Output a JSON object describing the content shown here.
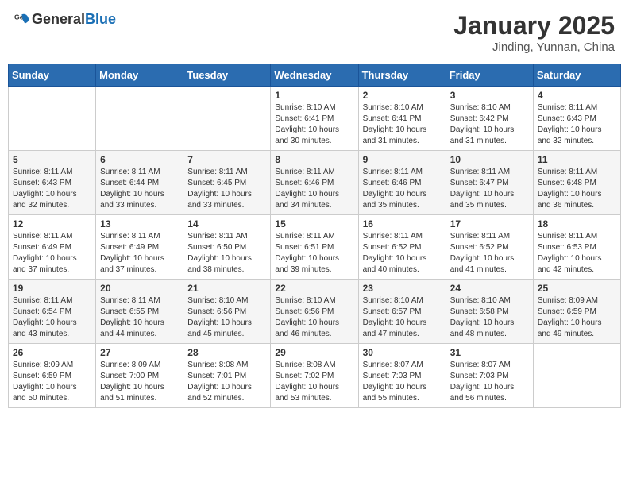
{
  "header": {
    "logo_general": "General",
    "logo_blue": "Blue",
    "month_title": "January 2025",
    "location": "Jinding, Yunnan, China"
  },
  "days_of_week": [
    "Sunday",
    "Monday",
    "Tuesday",
    "Wednesday",
    "Thursday",
    "Friday",
    "Saturday"
  ],
  "weeks": [
    [
      {
        "day": "",
        "info": ""
      },
      {
        "day": "",
        "info": ""
      },
      {
        "day": "",
        "info": ""
      },
      {
        "day": "1",
        "info": "Sunrise: 8:10 AM\nSunset: 6:41 PM\nDaylight: 10 hours\nand 30 minutes."
      },
      {
        "day": "2",
        "info": "Sunrise: 8:10 AM\nSunset: 6:41 PM\nDaylight: 10 hours\nand 31 minutes."
      },
      {
        "day": "3",
        "info": "Sunrise: 8:10 AM\nSunset: 6:42 PM\nDaylight: 10 hours\nand 31 minutes."
      },
      {
        "day": "4",
        "info": "Sunrise: 8:11 AM\nSunset: 6:43 PM\nDaylight: 10 hours\nand 32 minutes."
      }
    ],
    [
      {
        "day": "5",
        "info": "Sunrise: 8:11 AM\nSunset: 6:43 PM\nDaylight: 10 hours\nand 32 minutes."
      },
      {
        "day": "6",
        "info": "Sunrise: 8:11 AM\nSunset: 6:44 PM\nDaylight: 10 hours\nand 33 minutes."
      },
      {
        "day": "7",
        "info": "Sunrise: 8:11 AM\nSunset: 6:45 PM\nDaylight: 10 hours\nand 33 minutes."
      },
      {
        "day": "8",
        "info": "Sunrise: 8:11 AM\nSunset: 6:46 PM\nDaylight: 10 hours\nand 34 minutes."
      },
      {
        "day": "9",
        "info": "Sunrise: 8:11 AM\nSunset: 6:46 PM\nDaylight: 10 hours\nand 35 minutes."
      },
      {
        "day": "10",
        "info": "Sunrise: 8:11 AM\nSunset: 6:47 PM\nDaylight: 10 hours\nand 35 minutes."
      },
      {
        "day": "11",
        "info": "Sunrise: 8:11 AM\nSunset: 6:48 PM\nDaylight: 10 hours\nand 36 minutes."
      }
    ],
    [
      {
        "day": "12",
        "info": "Sunrise: 8:11 AM\nSunset: 6:49 PM\nDaylight: 10 hours\nand 37 minutes."
      },
      {
        "day": "13",
        "info": "Sunrise: 8:11 AM\nSunset: 6:49 PM\nDaylight: 10 hours\nand 37 minutes."
      },
      {
        "day": "14",
        "info": "Sunrise: 8:11 AM\nSunset: 6:50 PM\nDaylight: 10 hours\nand 38 minutes."
      },
      {
        "day": "15",
        "info": "Sunrise: 8:11 AM\nSunset: 6:51 PM\nDaylight: 10 hours\nand 39 minutes."
      },
      {
        "day": "16",
        "info": "Sunrise: 8:11 AM\nSunset: 6:52 PM\nDaylight: 10 hours\nand 40 minutes."
      },
      {
        "day": "17",
        "info": "Sunrise: 8:11 AM\nSunset: 6:52 PM\nDaylight: 10 hours\nand 41 minutes."
      },
      {
        "day": "18",
        "info": "Sunrise: 8:11 AM\nSunset: 6:53 PM\nDaylight: 10 hours\nand 42 minutes."
      }
    ],
    [
      {
        "day": "19",
        "info": "Sunrise: 8:11 AM\nSunset: 6:54 PM\nDaylight: 10 hours\nand 43 minutes."
      },
      {
        "day": "20",
        "info": "Sunrise: 8:11 AM\nSunset: 6:55 PM\nDaylight: 10 hours\nand 44 minutes."
      },
      {
        "day": "21",
        "info": "Sunrise: 8:10 AM\nSunset: 6:56 PM\nDaylight: 10 hours\nand 45 minutes."
      },
      {
        "day": "22",
        "info": "Sunrise: 8:10 AM\nSunset: 6:56 PM\nDaylight: 10 hours\nand 46 minutes."
      },
      {
        "day": "23",
        "info": "Sunrise: 8:10 AM\nSunset: 6:57 PM\nDaylight: 10 hours\nand 47 minutes."
      },
      {
        "day": "24",
        "info": "Sunrise: 8:10 AM\nSunset: 6:58 PM\nDaylight: 10 hours\nand 48 minutes."
      },
      {
        "day": "25",
        "info": "Sunrise: 8:09 AM\nSunset: 6:59 PM\nDaylight: 10 hours\nand 49 minutes."
      }
    ],
    [
      {
        "day": "26",
        "info": "Sunrise: 8:09 AM\nSunset: 6:59 PM\nDaylight: 10 hours\nand 50 minutes."
      },
      {
        "day": "27",
        "info": "Sunrise: 8:09 AM\nSunset: 7:00 PM\nDaylight: 10 hours\nand 51 minutes."
      },
      {
        "day": "28",
        "info": "Sunrise: 8:08 AM\nSunset: 7:01 PM\nDaylight: 10 hours\nand 52 minutes."
      },
      {
        "day": "29",
        "info": "Sunrise: 8:08 AM\nSunset: 7:02 PM\nDaylight: 10 hours\nand 53 minutes."
      },
      {
        "day": "30",
        "info": "Sunrise: 8:07 AM\nSunset: 7:03 PM\nDaylight: 10 hours\nand 55 minutes."
      },
      {
        "day": "31",
        "info": "Sunrise: 8:07 AM\nSunset: 7:03 PM\nDaylight: 10 hours\nand 56 minutes."
      },
      {
        "day": "",
        "info": ""
      }
    ]
  ]
}
